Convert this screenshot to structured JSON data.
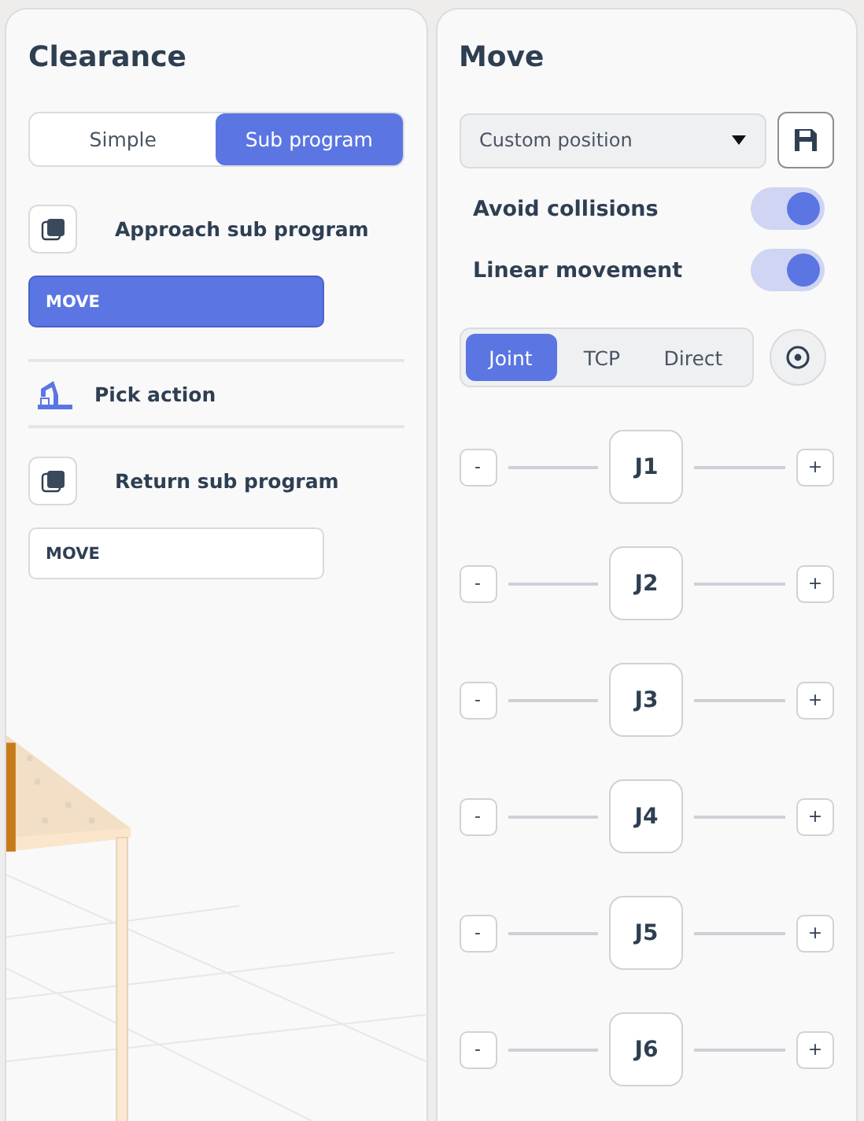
{
  "clearance": {
    "title": "Clearance",
    "mode_tabs": [
      {
        "label": "Simple",
        "selected": false
      },
      {
        "label": "Sub program",
        "selected": true
      }
    ],
    "items": [
      {
        "kind": "sub_program",
        "label": "Approach sub program",
        "value": "MOVE",
        "selected": true
      },
      {
        "kind": "action",
        "label": "Pick action"
      },
      {
        "kind": "sub_program",
        "label": "Return sub program",
        "value": "MOVE",
        "selected": false
      }
    ]
  },
  "move": {
    "title": "Move",
    "position_select": {
      "value": "Custom position"
    },
    "toggles": [
      {
        "label": "Avoid collisions",
        "on": true
      },
      {
        "label": "Linear movement",
        "on": true
      }
    ],
    "modes": [
      {
        "label": "Joint",
        "selected": true
      },
      {
        "label": "TCP",
        "selected": false
      },
      {
        "label": "Direct",
        "selected": false
      }
    ],
    "joints": [
      {
        "label": "J1",
        "minus": "-",
        "plus": "+"
      },
      {
        "label": "J2",
        "minus": "-",
        "plus": "+"
      },
      {
        "label": "J3",
        "minus": "-",
        "plus": "+"
      },
      {
        "label": "J4",
        "minus": "-",
        "plus": "+"
      },
      {
        "label": "J5",
        "minus": "-",
        "plus": "+"
      },
      {
        "label": "J6",
        "minus": "-",
        "plus": "+"
      }
    ]
  }
}
